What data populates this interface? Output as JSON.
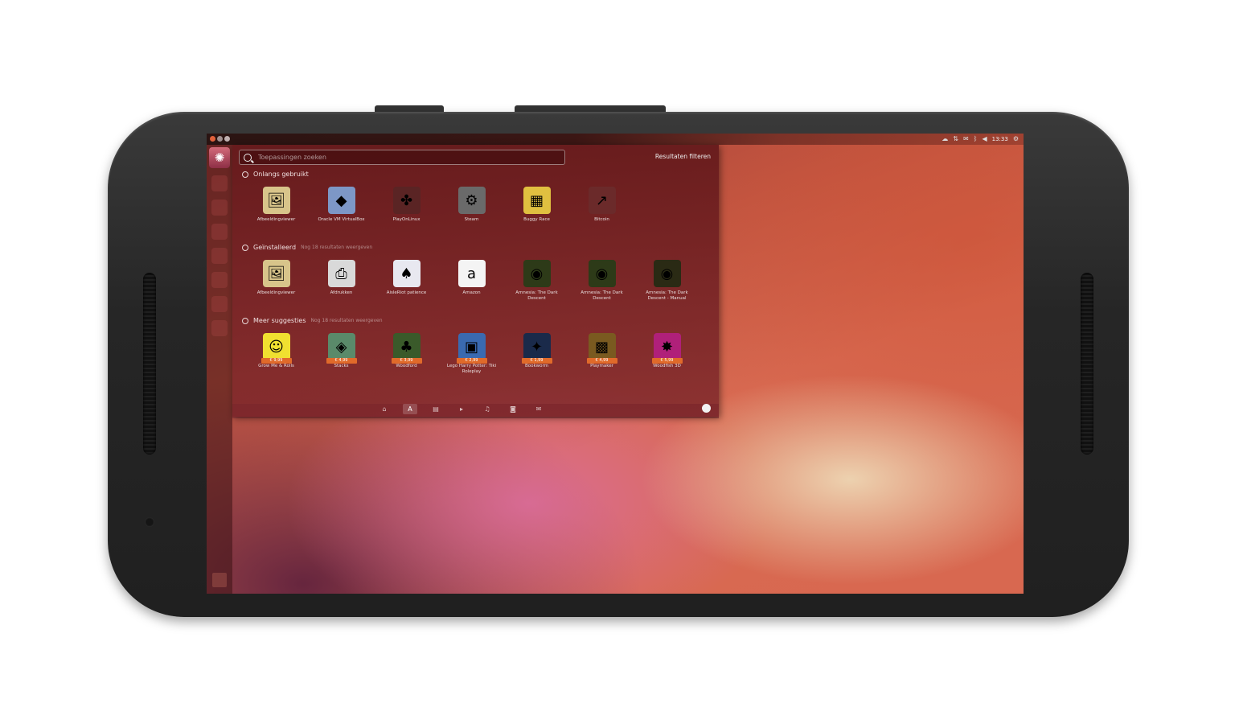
{
  "dash": {
    "search_placeholder": "Toepassingen zoeken",
    "filter_label": "Resultaten filteren",
    "sections": [
      {
        "title": "Onlangs gebruikt",
        "more": "",
        "items": [
          {
            "label": "Afbeeldingviewer",
            "icon": "image-viewer-icon",
            "glyph": "🖼",
            "bg": "#d8c48a",
            "price": ""
          },
          {
            "label": "Oracle VM VirtualBox",
            "icon": "virtualbox-icon",
            "glyph": "◆",
            "bg": "#7d97c6",
            "price": ""
          },
          {
            "label": "PlayOnLinux",
            "icon": "playonlinux-icon",
            "glyph": "✤",
            "bg": "#5a2424",
            "price": ""
          },
          {
            "label": "Steam",
            "icon": "steam-icon",
            "glyph": "⚙",
            "bg": "#6a6a6a",
            "price": ""
          },
          {
            "label": "Buggy Race",
            "icon": "buggy-race-icon",
            "glyph": "▦",
            "bg": "#e0c040",
            "price": ""
          },
          {
            "label": "Bitcoin",
            "icon": "bitcoin-icon",
            "glyph": "↗",
            "bg": "#6b2a2a",
            "price": ""
          }
        ]
      },
      {
        "title": "Geïnstalleerd",
        "more": "Nog 18 resultaten weergeven",
        "items": [
          {
            "label": "Afbeeldingviewer",
            "icon": "image-viewer-icon",
            "glyph": "🖼",
            "bg": "#d8c48a",
            "price": ""
          },
          {
            "label": "Afdrukken",
            "icon": "printer-icon",
            "glyph": "⎙",
            "bg": "#d9d9d9",
            "price": ""
          },
          {
            "label": "AisleRiot patience",
            "icon": "cards-icon",
            "glyph": "♠",
            "bg": "#e8e8f0",
            "price": ""
          },
          {
            "label": "Amazon",
            "icon": "amazon-icon",
            "glyph": "a",
            "bg": "#f4f4f4",
            "price": ""
          },
          {
            "label": "Amnesia: The Dark Descent",
            "icon": "amnesia-icon",
            "glyph": "◉",
            "bg": "#2d3a18",
            "price": ""
          },
          {
            "label": "Amnesia: The Dark Descent",
            "icon": "amnesia-icon",
            "glyph": "◉",
            "bg": "#2d3a18",
            "price": ""
          },
          {
            "label": "Amnesia: The Dark Descent - Manual",
            "icon": "amnesia-manual-icon",
            "glyph": "◉",
            "bg": "#2a2a14",
            "price": ""
          }
        ]
      },
      {
        "title": "Meer suggesties",
        "more": "Nog 18 resultaten weergeven",
        "items": [
          {
            "label": "Grow Me & Rolls",
            "icon": "smiley-game-icon",
            "glyph": "☺",
            "bg": "#f0e030",
            "price": "€ 9,99"
          },
          {
            "label": "Stacks",
            "icon": "stacks-game-icon",
            "glyph": "◈",
            "bg": "#5a8a6a",
            "price": "€ 4,99"
          },
          {
            "label": "Woodford",
            "icon": "woodford-game-icon",
            "glyph": "♣",
            "bg": "#3a5a2a",
            "price": "€ 3,99"
          },
          {
            "label": "Lego Harry Potter: Tiki Roleplay",
            "icon": "lego-game-icon",
            "glyph": "▣",
            "bg": "#3a6ab0",
            "price": "€ 2,99"
          },
          {
            "label": "Bookworm",
            "icon": "bookworm-game-icon",
            "glyph": "✦",
            "bg": "#1a2a4a",
            "price": "€ 1,99"
          },
          {
            "label": "Playmaker",
            "icon": "playmaker-game-icon",
            "glyph": "▩",
            "bg": "#7a5a20",
            "price": "€ 4,99"
          },
          {
            "label": "Woodfish 3D",
            "icon": "woodfish-game-icon",
            "glyph": "✸",
            "bg": "#b0207a",
            "price": "€ 5,99"
          }
        ]
      }
    ],
    "lenses": [
      {
        "name": "home-lens-icon",
        "glyph": "⌂",
        "active": false
      },
      {
        "name": "applications-lens-icon",
        "glyph": "A",
        "active": true
      },
      {
        "name": "files-lens-icon",
        "glyph": "▤",
        "active": false
      },
      {
        "name": "video-lens-icon",
        "glyph": "▸",
        "active": false
      },
      {
        "name": "music-lens-icon",
        "glyph": "♫",
        "active": false
      },
      {
        "name": "photos-lens-icon",
        "glyph": "◙",
        "active": false
      },
      {
        "name": "social-lens-icon",
        "glyph": "✉",
        "active": false
      }
    ]
  },
  "topbar": {
    "clock": "13:33"
  }
}
